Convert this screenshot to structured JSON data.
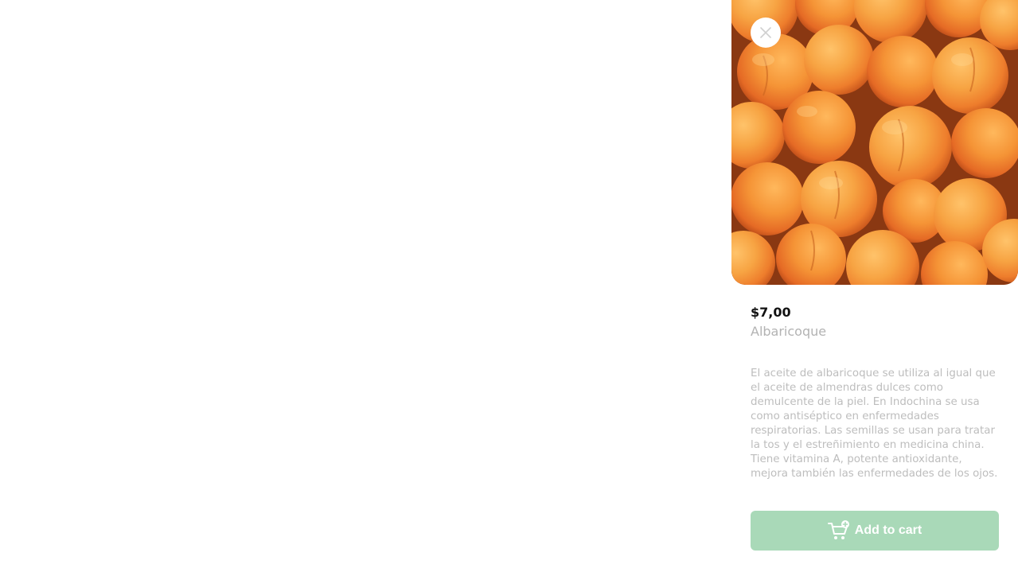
{
  "product": {
    "price": "$7,00",
    "name": "Albaricoque",
    "description": "El aceite de albaricoque se utiliza al igual que el aceite de almendras dulces como demulcente de la piel. En Indochina se usa como antiséptico en enfermedades respiratorias. Las semillas se usan para tratar la tos y el estreñimiento en medicina china. Tiene vitamina A, potente antioxidante, mejora también las enfermedades de los ojos.",
    "image_icon": "apricots-photo"
  },
  "actions": {
    "add_to_cart_label": "Add to cart",
    "close_icon": "close-icon",
    "cart_icon": "cart-plus-icon"
  },
  "colors": {
    "button_background": "#a9d9b8",
    "price_text": "#111111",
    "muted_text": "#b3b3b3"
  }
}
